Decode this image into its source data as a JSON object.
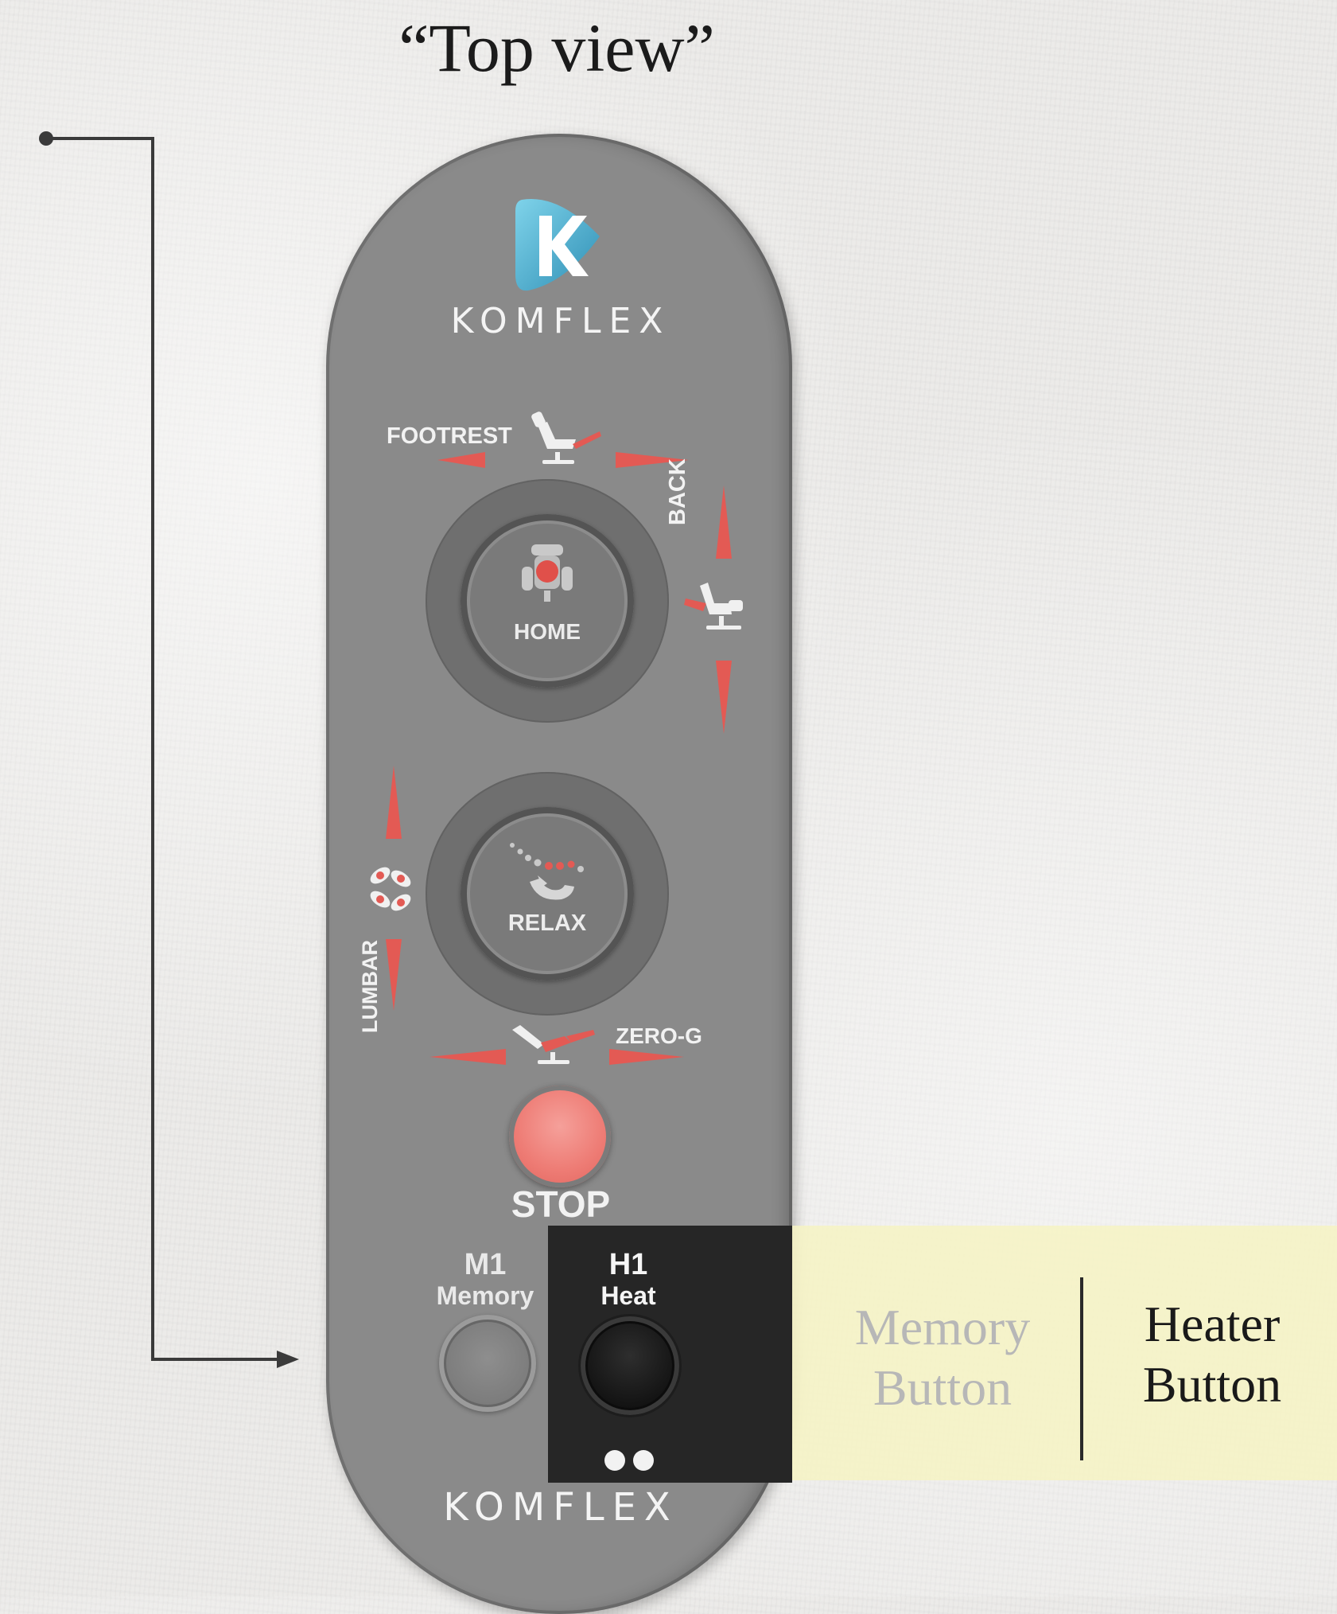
{
  "title": "“Top view”",
  "remote": {
    "brand": "KOMFLEX",
    "brand_bottom": "KOMFLEX",
    "logo_letter": "K",
    "labels": {
      "footrest": "FOOTREST",
      "back": "BACK",
      "lumbar": "LUMBAR",
      "zero_g": "ZERO-G",
      "home": "HOME",
      "relax": "RELAX",
      "stop": "STOP"
    },
    "buttons": {
      "m1_code": "M1",
      "m1_name": "Memory",
      "h1_code": "H1",
      "h1_name": "Heat"
    }
  },
  "callouts": {
    "memory": [
      "Memory",
      "Button"
    ],
    "heater": [
      "Heater",
      "Button"
    ]
  },
  "colors": {
    "remote_body": "#8a8a8a",
    "accent_red": "#e35a54",
    "highlight_yellow": "#f6f3c3",
    "highlight_dark": "#262626"
  }
}
